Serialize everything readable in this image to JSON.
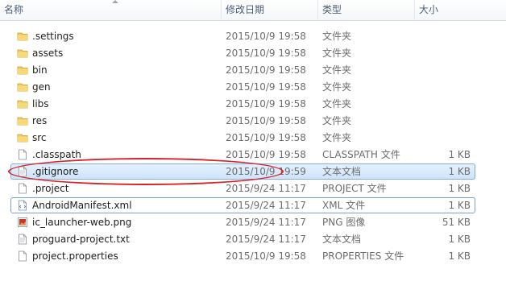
{
  "columns": {
    "name": "名称",
    "modified": "修改日期",
    "type": "类型",
    "size": "大小"
  },
  "files": [
    {
      "name": ".settings",
      "modified": "2015/10/9 19:58",
      "type": "文件夹",
      "size": "",
      "icon": "folder-icon"
    },
    {
      "name": "assets",
      "modified": "2015/10/9 19:58",
      "type": "文件夹",
      "size": "",
      "icon": "folder-icon"
    },
    {
      "name": "bin",
      "modified": "2015/10/9 19:58",
      "type": "文件夹",
      "size": "",
      "icon": "folder-icon"
    },
    {
      "name": "gen",
      "modified": "2015/10/9 19:58",
      "type": "文件夹",
      "size": "",
      "icon": "folder-icon"
    },
    {
      "name": "libs",
      "modified": "2015/10/9 19:58",
      "type": "文件夹",
      "size": "",
      "icon": "folder-icon"
    },
    {
      "name": "res",
      "modified": "2015/10/9 19:58",
      "type": "文件夹",
      "size": "",
      "icon": "folder-icon"
    },
    {
      "name": "src",
      "modified": "2015/10/9 19:58",
      "type": "文件夹",
      "size": "",
      "icon": "folder-icon"
    },
    {
      "name": ".classpath",
      "modified": "2015/10/9 19:58",
      "type": "CLASSPATH 文件",
      "size": "1 KB",
      "icon": "file-icon"
    },
    {
      "name": ".gitignore",
      "modified": "2015/10/9 19:59",
      "type": "文本文档",
      "size": "1 KB",
      "icon": "text-file-icon"
    },
    {
      "name": ".project",
      "modified": "2015/9/24 11:17",
      "type": "PROJECT 文件",
      "size": "1 KB",
      "icon": "file-icon"
    },
    {
      "name": "AndroidManifest.xml",
      "modified": "2015/9/24 11:17",
      "type": "XML 文件",
      "size": "1 KB",
      "icon": "xml-file-icon"
    },
    {
      "name": "ic_launcher-web.png",
      "modified": "2015/9/24 11:17",
      "type": "PNG 图像",
      "size": "51 KB",
      "icon": "image-file-icon"
    },
    {
      "name": "proguard-project.txt",
      "modified": "2015/9/24 11:17",
      "type": "文本文档",
      "size": "1 KB",
      "icon": "text-file-icon"
    },
    {
      "name": "project.properties",
      "modified": "2015/10/9 19:58",
      "type": "PROPERTIES 文件",
      "size": "1 KB",
      "icon": "file-icon"
    }
  ],
  "selected_file": ".gitignore",
  "focused_file": "AndroidManifest.xml",
  "colors": {
    "selection_fill": "#cfe4fb",
    "selection_border": "#84acdd",
    "annotation_circle": "#d6232a",
    "folder": "#e8c05a"
  }
}
